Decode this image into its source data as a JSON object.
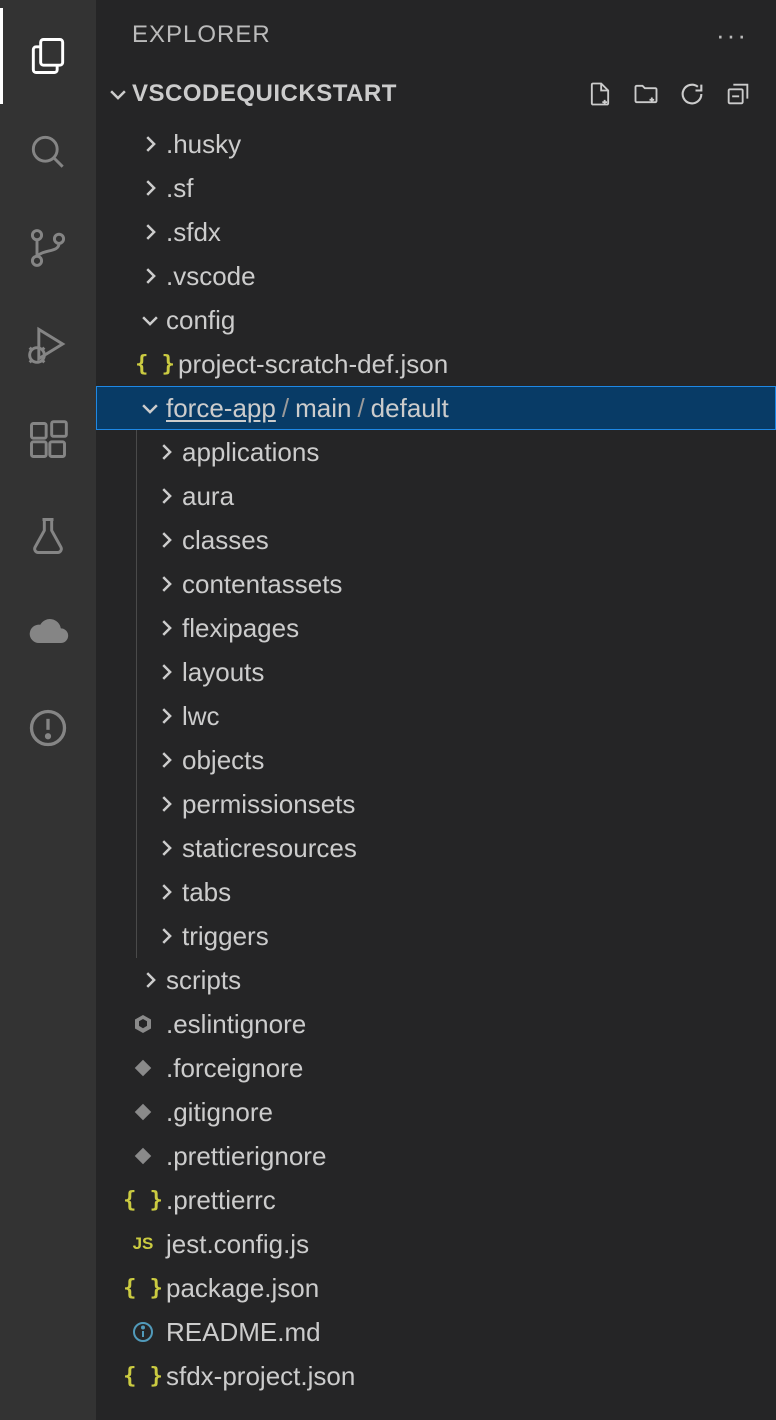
{
  "sidebar": {
    "title": "EXPLORER"
  },
  "project": {
    "name": "VSCODEQUICKSTART"
  },
  "tree": {
    "husky": ".husky",
    "sf": ".sf",
    "sfdx": ".sfdx",
    "vscode": ".vscode",
    "config": "config",
    "config_child": "project-scratch-def.json",
    "forceapp": {
      "seg1": "force-app",
      "seg2": "main",
      "seg3": "default"
    },
    "fa_children": {
      "applications": "applications",
      "aura": "aura",
      "classes": "classes",
      "contentassets": "contentassets",
      "flexipages": "flexipages",
      "layouts": "layouts",
      "lwc": "lwc",
      "objects": "objects",
      "permissionsets": "permissionsets",
      "staticresources": "staticresources",
      "tabs": "tabs",
      "triggers": "triggers"
    },
    "scripts": "scripts",
    "eslintignore": ".eslintignore",
    "forceignore": ".forceignore",
    "gitignore": ".gitignore",
    "prettierignore": ".prettierignore",
    "prettierrc": ".prettierrc",
    "jestconfig": "jest.config.js",
    "packagejson": "package.json",
    "readme": "README.md",
    "sfdxproject": "sfdx-project.json"
  }
}
